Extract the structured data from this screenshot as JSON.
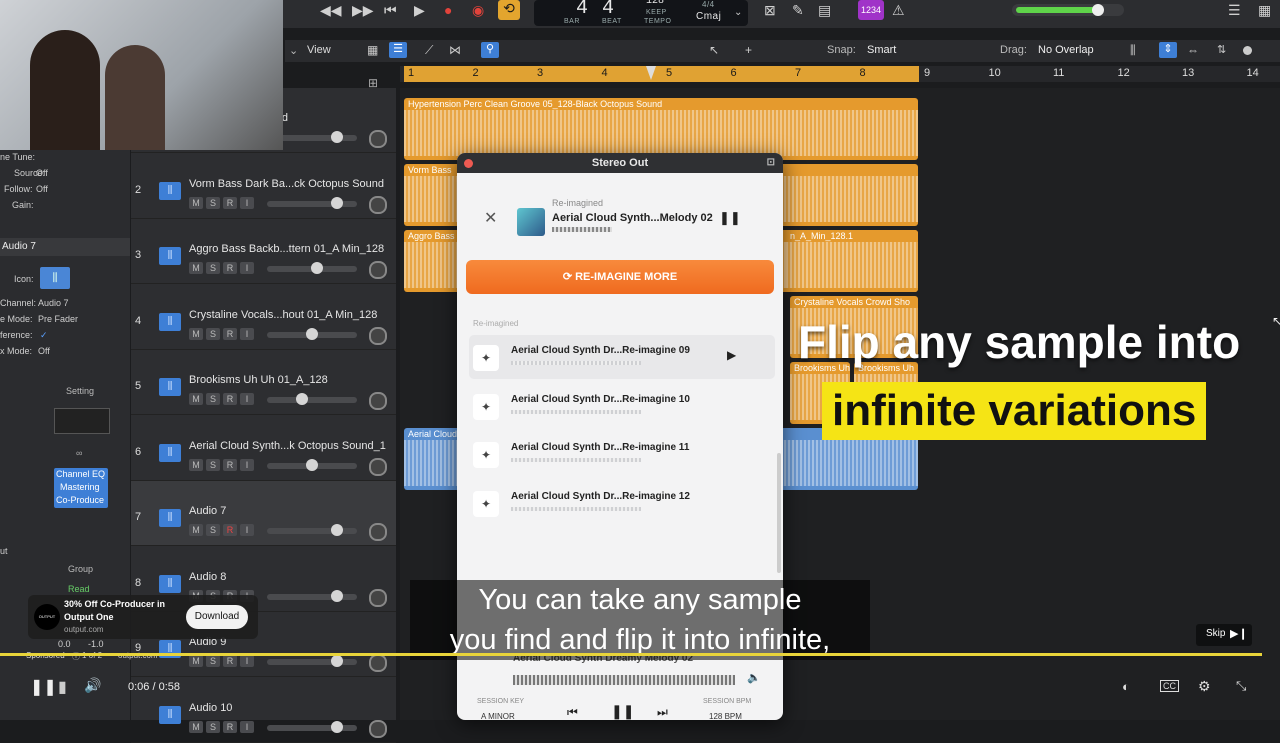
{
  "transport": {
    "bar_label": "BAR",
    "beat_label": "BEAT",
    "bar": "4",
    "beat": "4",
    "tempo": "128",
    "tempo_label": "KEEP",
    "tempo_sub": "TEMPO",
    "signature": "4/4",
    "key": "Cmaj",
    "badge": "1234"
  },
  "toolbar": {
    "view": "View",
    "snap_label": "Snap:",
    "snap_value": "Smart",
    "drag_label": "Drag:",
    "drag_value": "No Overlap"
  },
  "ruler": [
    "1",
    "2",
    "3",
    "4",
    "5",
    "6",
    "7",
    "8",
    "9",
    "10",
    "11",
    "12",
    "13",
    "14"
  ],
  "inspector": {
    "fine_tune": "ne Tune:",
    "source_label": "Source:",
    "source_value": "Off",
    "follow_label": "Follow:",
    "follow_value": "Off",
    "gain_label": "Gain:",
    "section": "Audio 7",
    "icon_label": "Icon:",
    "channel_label": "Channel:",
    "channel_value": "Audio 7",
    "mode_label": "e Mode:",
    "mode_value": "Pre Fader",
    "ference_label": "ference:",
    "xmode_label": "x Mode:",
    "xmode_value": "Off",
    "setting": "Setting",
    "plugins": [
      "Channel EQ",
      "Mastering",
      "Co-Produce"
    ],
    "group": "Group",
    "read": "Read",
    "ut": "ut",
    "level_left": "0.0",
    "level_right": "-1.0"
  },
  "tracks": [
    {
      "num": "",
      "name": "...ck Octopus Sound"
    },
    {
      "num": "2",
      "name": "Vorm Bass Dark Ba...ck Octopus Sound"
    },
    {
      "num": "3",
      "name": "Aggro Bass Backb...ttern 01_A Min_128"
    },
    {
      "num": "4",
      "name": "Crystaline Vocals...hout 01_A Min_128"
    },
    {
      "num": "5",
      "name": "Brookisms Uh Uh 01_A_128"
    },
    {
      "num": "6",
      "name": "Aerial Cloud Synth...k Octopus Sound_1"
    },
    {
      "num": "7",
      "name": "Audio 7"
    },
    {
      "num": "8",
      "name": "Audio 8"
    },
    {
      "num": "9",
      "name": "Audio 9"
    },
    {
      "num": "",
      "name": "Audio 10"
    }
  ],
  "msri": [
    "M",
    "S",
    "R",
    "I"
  ],
  "regions": {
    "r1": "Hypertension Perc Clean Groove 05_128-Black Octopus Sound",
    "r2": "Vorm Bass",
    "r3": "Aggro Bass",
    "r3b": "n_A_Min_128.1",
    "r4": "Crystaline Vocals Crowd Sho",
    "r5a": "Brookisms Uh",
    "r5b": "Brookisms Uh",
    "r6": "Aerial Cloud"
  },
  "plugin": {
    "title": "Stereo Out",
    "now_label": "Re-imagined",
    "now_name": "Aerial Cloud Synth...Melody 02",
    "button": "RE-IMAGINE MORE",
    "list_label": "Re-imagined",
    "variations": [
      "Aerial Cloud Synth Dr...Re-imagine 09",
      "Aerial Cloud Synth Dr...Re-imagine 10",
      "Aerial Cloud Synth Dr...Re-imagine 11",
      "Aerial Cloud Synth Dr...Re-imagine 12"
    ],
    "footer_name": "Aerial Cloud Synth Dreamy Melody 02",
    "session_key_label": "SESSION KEY",
    "session_key": "A MINOR",
    "session_bpm_label": "SESSION BPM",
    "session_bpm": "128 BPM"
  },
  "overlay": {
    "headline_line1": "Flip any sample into",
    "headline_line2": "infinite variations",
    "caption_line1": "You can take any sample",
    "caption_line2": "you find and flip it into infinite,"
  },
  "ad": {
    "line1": "30% Off Co-Producer in",
    "line2": "Output One",
    "url": "output.com",
    "download": "Download",
    "sponsored": "Sponsored",
    "count": "1 of 2",
    "domain": "output.com",
    "logo": "OUTPUT"
  },
  "player": {
    "time": "0:06 / 0:58",
    "skip": "Skip",
    "cc": "CC"
  },
  "colors": {
    "accent_orange": "#ef6a1f",
    "region_orange": "#e59a2d",
    "region_blue": "#5a8fd0",
    "headline_bg": "#f5e415",
    "progress": "#e8d43a"
  }
}
